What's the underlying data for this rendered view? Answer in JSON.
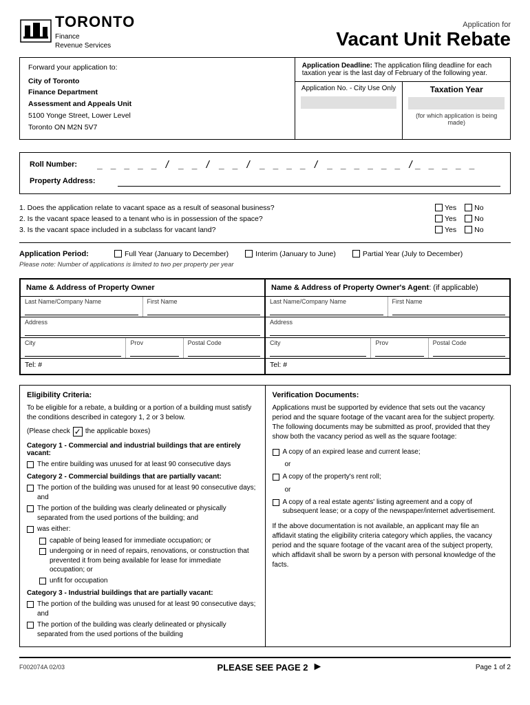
{
  "header": {
    "app_for": "Application for",
    "main_title": "Vacant Unit Rebate",
    "logo_name": "TORONTO",
    "logo_sub1": "Finance",
    "logo_sub2": "Revenue Services"
  },
  "top_info": {
    "forward_text": "Forward your application to:",
    "address_line1": "City of Toronto",
    "address_line2": "Finance Department",
    "address_line3": "Assessment and Appeals Unit",
    "address_line4": "5100 Yonge Street, Lower Level",
    "address_line5": "Toronto ON  M2N 5V7",
    "deadline_label": "Application Deadline:",
    "deadline_text": "The application filing deadline for each taxation year is the last day of February of the following year.",
    "app_no_label": "Application No. - City Use Only",
    "tax_year_label": "Taxation Year",
    "tax_year_note": "(for which application is being made)"
  },
  "roll_section": {
    "roll_label": "Roll Number:",
    "roll_pattern": "_ _ _ _ _ / _ _ / _ _ / _ _ _ _ / _ _ _ _ _ _ /_ _ _ _ _",
    "prop_addr_label": "Property Address:"
  },
  "questions": [
    {
      "text": "1. Does the application relate to vacant space as a result of seasonal business?",
      "yes": "Yes",
      "no": "No"
    },
    {
      "text": "2. Is the vacant space leased to a tenant who is in possession of the space?",
      "yes": "Yes",
      "no": "No"
    },
    {
      "text": "3. Is the vacant space included in a subclass for vacant land?",
      "yes": "Yes",
      "no": "No"
    }
  ],
  "app_period": {
    "label": "Application Period:",
    "options": [
      "Full Year (January to December)",
      "Interim (January to June)",
      "Partial Year (July to December)"
    ],
    "note": "Please note:  Number of applications is limited to two per property per year"
  },
  "owner_section": {
    "header": "Name & Address of Property Owner",
    "last_name_label": "Last Name/Company Name",
    "first_name_label": "First Name",
    "address_label": "Address",
    "city_label": "City",
    "prov_label": "Prov",
    "postal_label": "Postal Code",
    "tel_label": "Tel: #"
  },
  "agent_section": {
    "header": "Name & Address of Property Owner's Agent",
    "header_suffix": ": (if applicable)",
    "last_name_label": "Last Name/Company Name",
    "first_name_label": "First Name",
    "address_label": "Address",
    "city_label": "City",
    "prov_label": "Prov",
    "postal_label": "Postal Code",
    "tel_label": "Tel: #"
  },
  "eligibility": {
    "title": "Eligibility Criteria:",
    "intro": "To be eligible for a rebate, a building or a portion of a building must satisfy the conditions described in category 1, 2 or 3 below.",
    "check_note": "the applicable boxes)",
    "check_prefix": "(Please check",
    "categories": [
      {
        "title": "Category 1 - Commercial and industrial buildings that are entirely vacant:",
        "items": [
          "The entire building was unused for at least 90 consecutive days"
        ]
      },
      {
        "title": "Category 2 - Commercial buildings that are partially vacant:",
        "items": [
          "The portion of the building was unused for at least 90 consecutive days; and",
          "The portion of the building was clearly delineated or physically separated from the used portions of the building; and",
          "was either:"
        ],
        "sub_items": [
          "capable of being leased for immediate occupation; or",
          "undergoing or in need of repairs, renovations, or construction that prevented it from being available for lease for immediate occupation; or",
          "unfit for occupation"
        ]
      },
      {
        "title": "Category 3 - Industrial buildings that are partially vacant:",
        "items": [
          "The portion of the building was unused for at least 90 consecutive days; and",
          "The portion of the building was clearly delineated or physically separated from the used portions of the building"
        ]
      }
    ]
  },
  "verification": {
    "title": "Verification Documents:",
    "intro": "Applications must be supported by evidence that sets out the vacancy period and the square footage of the vacant area for the subject property. The following documents may be submitted as proof, provided that they show both the vacancy period as well as the square footage:",
    "items": [
      "A copy of an expired lease and current lease;",
      "A copy of the property's rent roll;",
      "A copy of a real estate agents' listing agreement and a copy of subsequent lease; or a copy of the newspaper/internet advertisement."
    ],
    "or_text": "or",
    "footer": "If the above documentation is not available, an applicant may file an affidavit stating the eligibility criteria category which applies, the vacancy period and the square footage of the vacant area of the subject property, which affidavit shall be sworn by a person with personal knowledge of the facts."
  },
  "footer": {
    "see_page2": "PLEASE SEE PAGE 2",
    "page_num": "Page 1 of 2",
    "form_code": "F002074A 02/03"
  }
}
